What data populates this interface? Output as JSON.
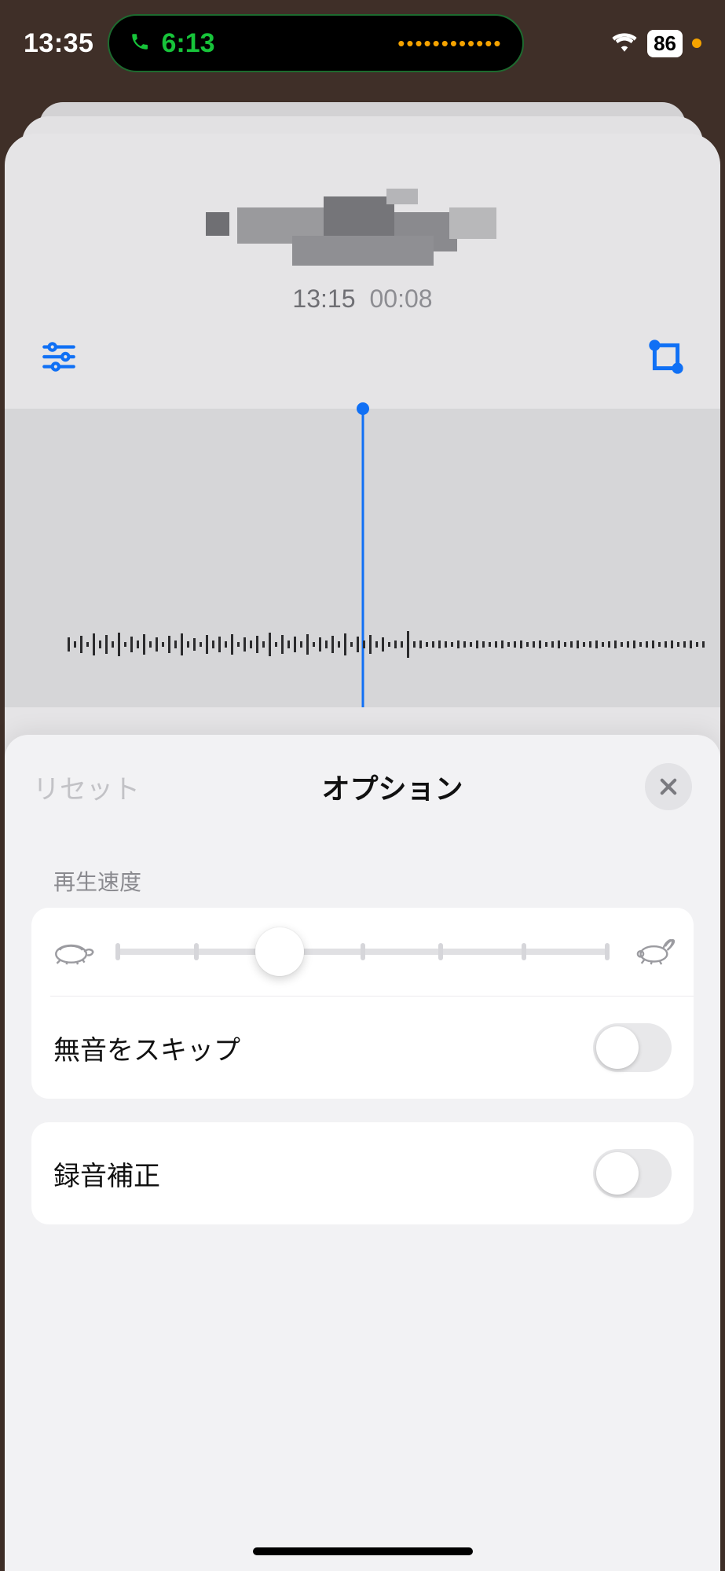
{
  "status": {
    "time": "13:35",
    "call_duration": "6:13",
    "battery": "86"
  },
  "recording": {
    "time": "13:15",
    "duration": "00:08"
  },
  "sheet": {
    "reset": "リセット",
    "title": "オプション",
    "speed_label": "再生速度",
    "skip_silence": "無音をスキップ",
    "enhance": "録音補正"
  }
}
